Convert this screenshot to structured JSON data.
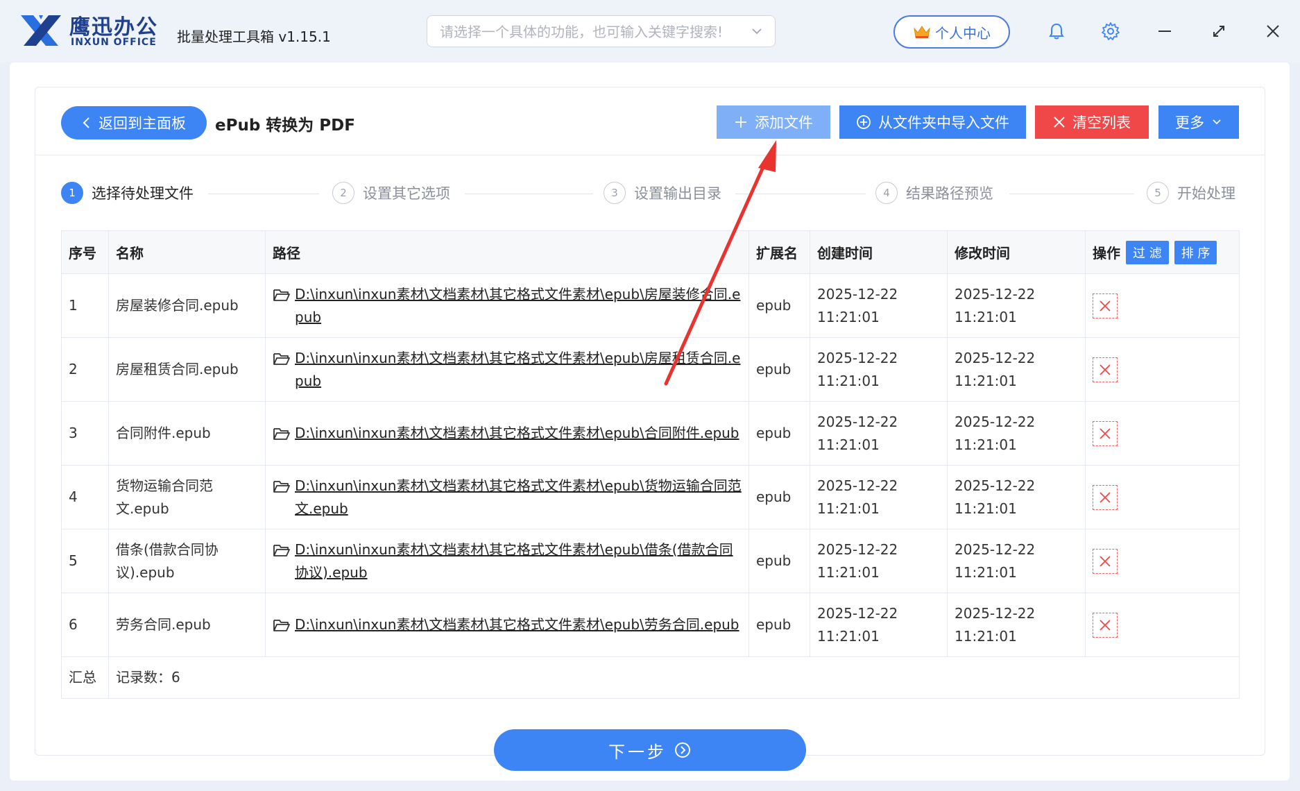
{
  "app": {
    "brand_cn": "鹰迅办公",
    "brand_en": "INXUN OFFICE",
    "title": "批量处理工具箱 v1.15.1",
    "search_placeholder": "请选择一个具体的功能，也可输入关键字搜索!",
    "user_center": "个人中心",
    "accent_color": "#3d84f4"
  },
  "header": {
    "back_label": "返回到主面板",
    "page_title": "ePub 转换为 PDF",
    "add_file": "添加文件",
    "import_folder": "从文件夹中导入文件",
    "clear_list": "清空列表",
    "more": "更多"
  },
  "steps": [
    {
      "num": "1",
      "label": "选择待处理文件"
    },
    {
      "num": "2",
      "label": "设置其它选项"
    },
    {
      "num": "3",
      "label": "设置输出目录"
    },
    {
      "num": "4",
      "label": "结果路径预览"
    },
    {
      "num": "5",
      "label": "开始处理"
    }
  ],
  "table": {
    "columns": {
      "index": "序号",
      "name": "名称",
      "path": "路径",
      "ext": "扩展名",
      "created": "创建时间",
      "modified": "修改时间",
      "ops": "操作",
      "filter": "过 滤",
      "sort": "排 序"
    },
    "rows": [
      {
        "index": "1",
        "name": "房屋装修合同.epub",
        "path": "D:\\inxun\\inxun素材\\文档素材\\其它格式文件素材\\epub\\房屋装修合同.epub",
        "ext": "epub",
        "created": "2025-12-22 11:21:01",
        "modified": "2025-12-22 11:21:01"
      },
      {
        "index": "2",
        "name": "房屋租赁合同.epub",
        "path": "D:\\inxun\\inxun素材\\文档素材\\其它格式文件素材\\epub\\房屋租赁合同.epub",
        "ext": "epub",
        "created": "2025-12-22 11:21:01",
        "modified": "2025-12-22 11:21:01"
      },
      {
        "index": "3",
        "name": "合同附件.epub",
        "path": "D:\\inxun\\inxun素材\\文档素材\\其它格式文件素材\\epub\\合同附件.epub",
        "ext": "epub",
        "created": "2025-12-22 11:21:01",
        "modified": "2025-12-22 11:21:01"
      },
      {
        "index": "4",
        "name": "货物运输合同范文.epub",
        "path": "D:\\inxun\\inxun素材\\文档素材\\其它格式文件素材\\epub\\货物运输合同范文.epub",
        "ext": "epub",
        "created": "2025-12-22 11:21:01",
        "modified": "2025-12-22 11:21:01"
      },
      {
        "index": "5",
        "name": "借条(借款合同协议).epub",
        "path": "D:\\inxun\\inxun素材\\文档素材\\其它格式文件素材\\epub\\借条(借款合同协议).epub",
        "ext": "epub",
        "created": "2025-12-22 11:21:01",
        "modified": "2025-12-22 11:21:01"
      },
      {
        "index": "6",
        "name": "劳务合同.epub",
        "path": "D:\\inxun\\inxun素材\\文档素材\\其它格式文件素材\\epub\\劳务合同.epub",
        "ext": "epub",
        "created": "2025-12-22 11:21:01",
        "modified": "2025-12-22 11:21:01"
      }
    ],
    "summary_label": "汇总",
    "record_count": "记录数：6"
  },
  "footer": {
    "next": "下一步"
  }
}
